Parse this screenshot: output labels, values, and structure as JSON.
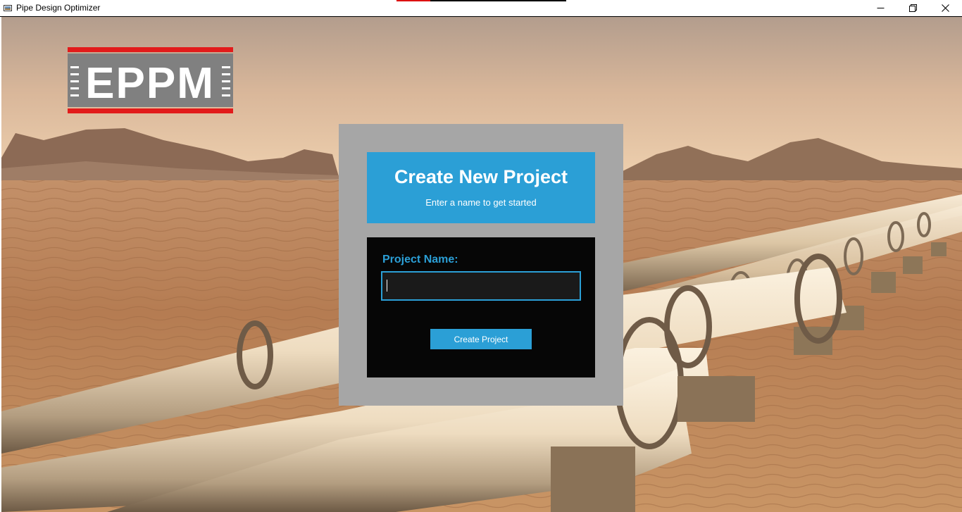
{
  "window": {
    "title": "Pip­e Design Optimizer",
    "controls": {
      "minimize_icon": "minimize-icon",
      "maximize_icon": "restore-icon",
      "close_icon": "close-icon"
    }
  },
  "logo": {
    "text": "EPPM",
    "colors": {
      "stripe": "#e21b1b",
      "box": "#808080",
      "text": "#ffffff"
    }
  },
  "dialog": {
    "title": "Create New Project",
    "subtitle": "Enter a name to get started",
    "field_label": "Project Name:",
    "input_value": "",
    "input_placeholder": "",
    "submit_label": "Create Project"
  },
  "colors": {
    "accent": "#2b9fd6",
    "panel": "#a6a6a6",
    "form_background": "#060606"
  }
}
